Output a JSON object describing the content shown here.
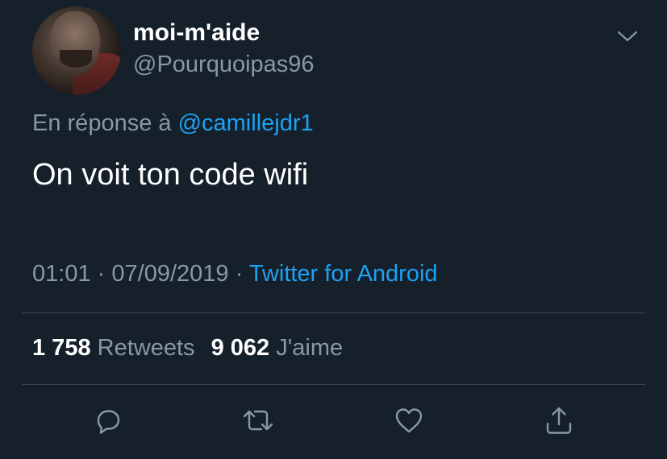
{
  "user": {
    "display_name": "moi-m'aide",
    "handle": "@Pourquoipas96"
  },
  "reply": {
    "prefix": "En réponse à",
    "mention": "@camillejdr1"
  },
  "tweet": {
    "text": "On voit ton code wifi"
  },
  "meta": {
    "time": "01:01",
    "separator": "·",
    "date": "07/09/2019",
    "source": "Twitter for Android"
  },
  "stats": {
    "retweets_count": "1 758",
    "retweets_label": "Retweets",
    "likes_count": "9 062",
    "likes_label": "J'aime"
  },
  "icons": {
    "menu": "chevron-down-icon",
    "reply": "reply-icon",
    "retweet": "retweet-icon",
    "like": "heart-icon",
    "share": "share-icon"
  },
  "colors": {
    "background": "#15202b",
    "accent": "#1da1f2",
    "secondary_text": "#8899a6",
    "divider": "#38444d"
  }
}
